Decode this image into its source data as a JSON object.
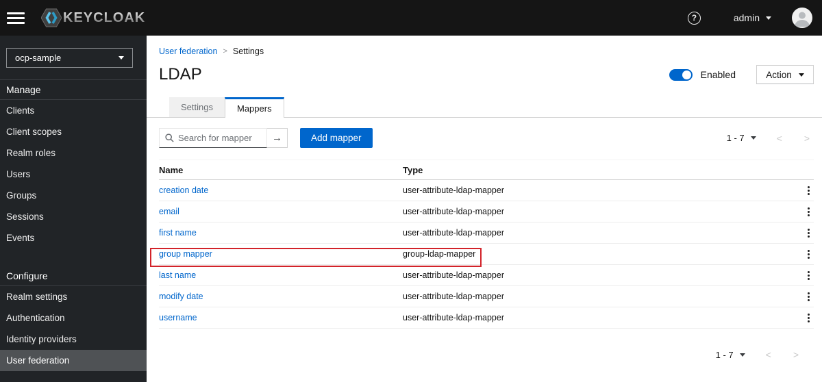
{
  "header": {
    "brand": "KEYCLOAK",
    "user": "admin",
    "help_glyph": "?"
  },
  "icons": {
    "hamburger-icon": "three horizontal bars / ≡",
    "keycloak-logo-icon": "gray hexagon with blue double chevron",
    "help-icon": "? in circle",
    "caret-down-icon": "▾",
    "avatar-icon": "person silhouette in circle",
    "search-icon": "magnifier ⌕",
    "arrow-right-icon": "→",
    "chevron-left-icon": "<",
    "chevron-right-icon": ">",
    "kebab-icon": "⋮ vertical three dots"
  },
  "colors": {
    "header_bg": "#151515",
    "sidebar_bg": "#212427",
    "selected_nav_bg": "#4f5255",
    "accent_blue": "#0066cc",
    "annotation_red": "#d2232a",
    "inactive_tab_bg": "#f0f0f0"
  },
  "sidebar": {
    "realm_selector": "ocp-sample",
    "selected_item": "User federation",
    "sections": [
      {
        "title": "Manage",
        "items": [
          "Clients",
          "Client scopes",
          "Realm roles",
          "Users",
          "Groups",
          "Sessions",
          "Events"
        ]
      },
      {
        "title": "Configure",
        "items": [
          "Realm settings",
          "Authentication",
          "Identity providers",
          "User federation"
        ]
      }
    ]
  },
  "page": {
    "breadcrumb": [
      "User federation",
      "Settings"
    ],
    "breadcrumb_separator": ">",
    "title": "LDAP",
    "enabled_label": "Enabled",
    "action_label": "Action"
  },
  "tabs": [
    {
      "label": "Settings",
      "active": false
    },
    {
      "label": "Mappers",
      "active": true
    }
  ],
  "toolbar": {
    "search_placeholder": "Search for mapper",
    "search_submit_glyph": "→",
    "add_button": "Add mapper"
  },
  "pagination": {
    "range": "1 - 7",
    "prev_glyph": "<",
    "next_glyph": ">"
  },
  "table": {
    "columns": [
      "Name",
      "Type"
    ],
    "rows": [
      {
        "name": "creation date",
        "type": "user-attribute-ldap-mapper",
        "highlighted": false
      },
      {
        "name": "email",
        "type": "user-attribute-ldap-mapper",
        "highlighted": false
      },
      {
        "name": "first name",
        "type": "user-attribute-ldap-mapper",
        "highlighted": false
      },
      {
        "name": "group mapper",
        "type": "group-ldap-mapper",
        "highlighted": true
      },
      {
        "name": "last name",
        "type": "user-attribute-ldap-mapper",
        "highlighted": false
      },
      {
        "name": "modify date",
        "type": "user-attribute-ldap-mapper",
        "highlighted": false
      },
      {
        "name": "username",
        "type": "user-attribute-ldap-mapper",
        "highlighted": false
      }
    ]
  }
}
